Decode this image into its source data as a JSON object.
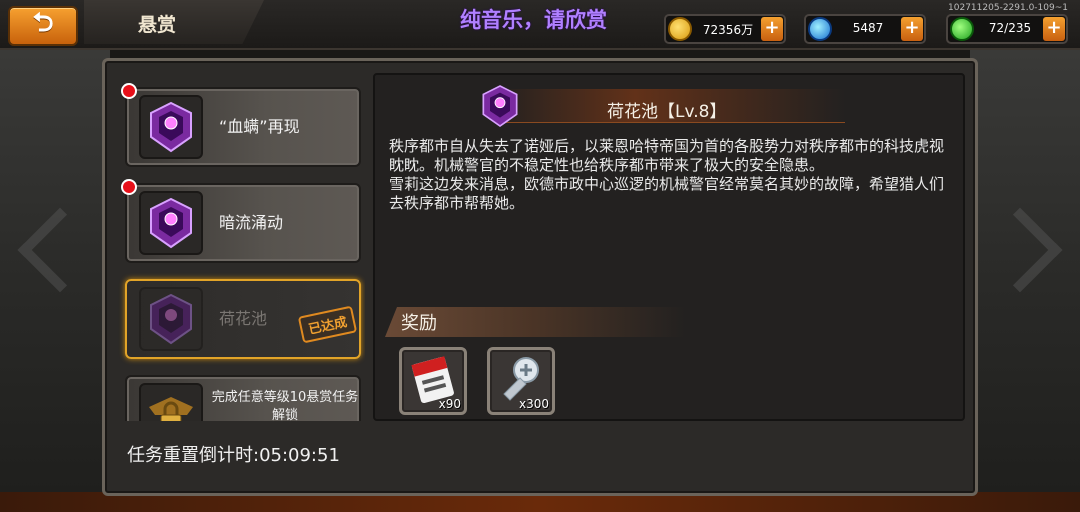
{
  "header": {
    "title": "悬赏",
    "watermark": "纯音乐，请欣赏",
    "build_info": "102711205-2291.0-109~1",
    "back_icon": "back-arrow-icon"
  },
  "resources": [
    {
      "icon": "gold-coin-icon",
      "value": "72356万"
    },
    {
      "icon": "blue-gem-icon",
      "value": "5487"
    },
    {
      "icon": "green-energy-icon",
      "value": "72/235"
    }
  ],
  "quests": [
    {
      "name": "“血螨”再现",
      "has_alert": true,
      "completed": false
    },
    {
      "name": "暗流涌动",
      "has_alert": true,
      "completed": false
    },
    {
      "name": "荷花池",
      "has_alert": false,
      "completed": true,
      "stamp": "已达成"
    },
    {
      "name": "完成任意等级10悬赏任务解锁",
      "locked": true
    }
  ],
  "reset_timer": "任务重置倒计时:05:09:51",
  "detail": {
    "title": "荷花池【Lv.8】",
    "description": [
      "秩序都市自从失去了诺娅后，以莱恩哈特帝国为首的各股势力对秩序都市的科技虎视眈眈。机械警官的不稳定性也给秩序都市带来了极大的安全隐患。",
      "雪莉这边发来消息，欧德市政中心巡逻的机械警官经常莫名其妙的故障，希望猎人们去秩序都市帮帮她。"
    ],
    "reward_label": "奖励",
    "rewards": [
      {
        "icon": "ticket-icon",
        "qty": "x90"
      },
      {
        "icon": "screw-icon",
        "qty": "x300"
      }
    ]
  },
  "colors": {
    "accent_orange": "#f0a030",
    "watermark_purple": "#b080ff",
    "alert_red": "#e8101a"
  }
}
